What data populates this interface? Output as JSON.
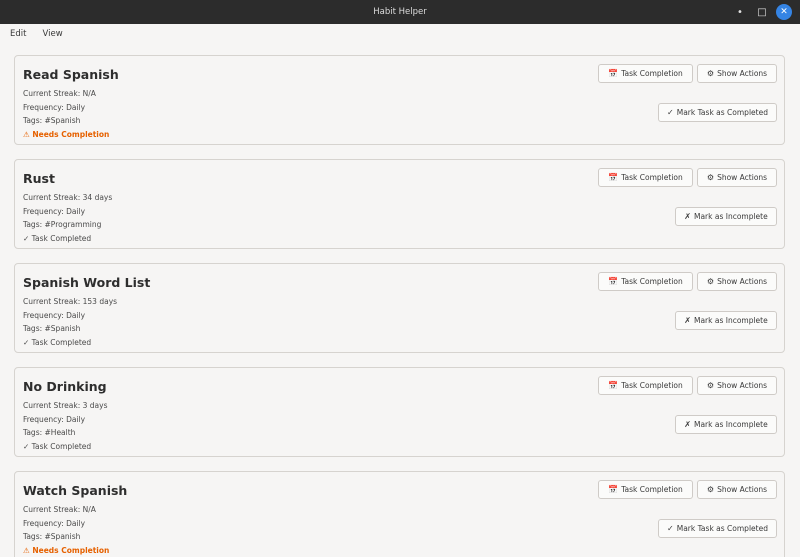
{
  "window": {
    "title": "Habit Helper",
    "controls": {
      "minimize": "•",
      "maximize": "□",
      "close": "✕"
    }
  },
  "menubar": {
    "items": [
      "Edit",
      "View"
    ]
  },
  "buttons": {
    "task_completion": "Task Completion",
    "show_actions": "Show Actions",
    "mark_completed": "Mark Task as Completed",
    "mark_incomplete": "Mark as Incomplete"
  },
  "icons": {
    "calendar": "📅",
    "gear": "⚙",
    "check": "✓",
    "cross": "✗",
    "warning": "⚠"
  },
  "colors": {
    "accent": "#3584e4",
    "warning": "#e66100",
    "calendar": "#c01c28"
  },
  "habits": [
    {
      "name": "Read Spanish",
      "streak": "Current Streak: N/A",
      "frequency": "Frequency: Daily",
      "tags": "Tags:  #Spanish",
      "status": "⚠ Needs Completion",
      "completed": false
    },
    {
      "name": "Rust",
      "streak": "Current Streak: 34 days",
      "frequency": "Frequency: Daily",
      "tags": "Tags:  #Programming",
      "status": "✓ Task Completed",
      "completed": true
    },
    {
      "name": "Spanish Word List",
      "streak": "Current Streak: 153 days",
      "frequency": "Frequency: Daily",
      "tags": "Tags:  #Spanish",
      "status": "✓ Task Completed",
      "completed": true
    },
    {
      "name": "No Drinking",
      "streak": "Current Streak: 3 days",
      "frequency": "Frequency: Daily",
      "tags": "Tags:  #Health",
      "status": "✓ Task Completed",
      "completed": true
    },
    {
      "name": "Watch Spanish",
      "streak": "Current Streak: N/A",
      "frequency": "Frequency: Daily",
      "tags": "Tags:  #Spanish",
      "status": "⚠ Needs Completion",
      "completed": false
    }
  ]
}
